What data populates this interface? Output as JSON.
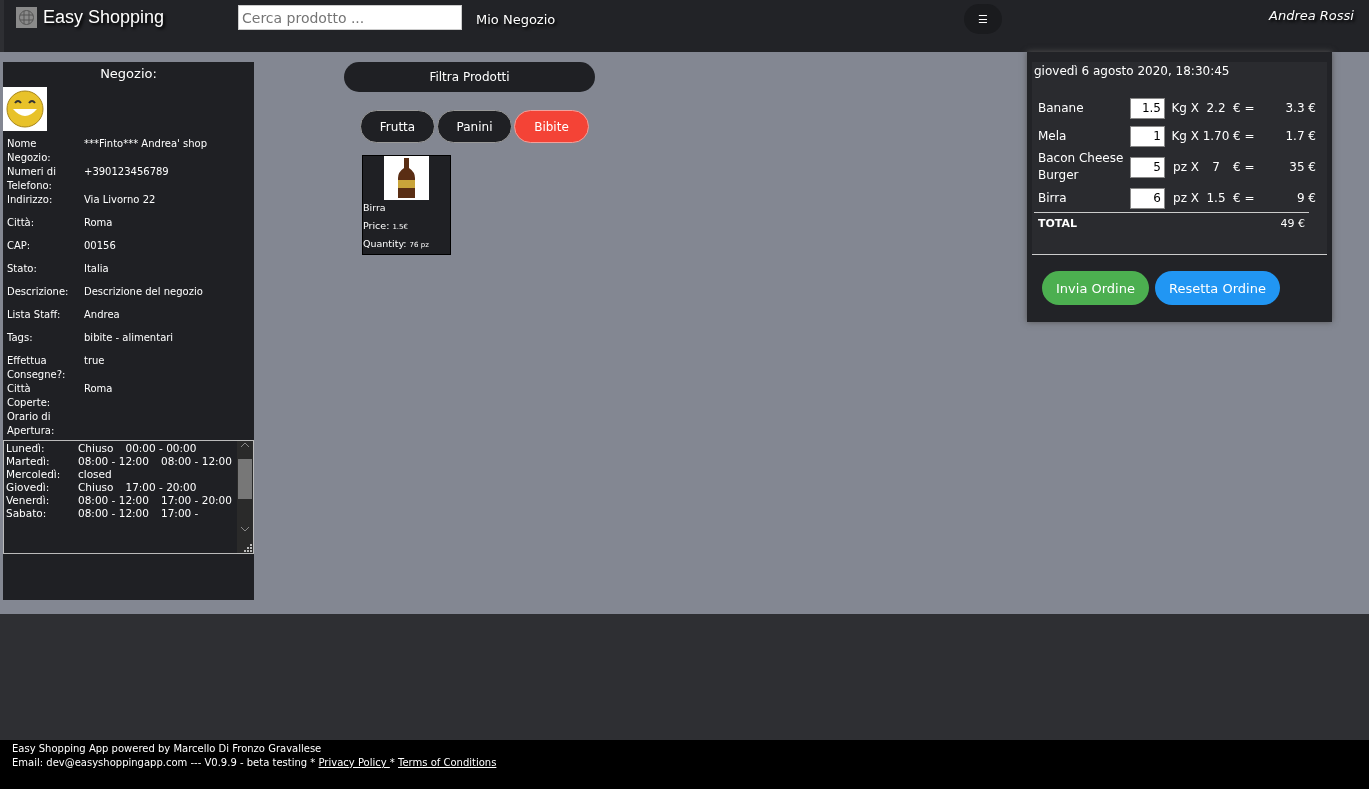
{
  "header": {
    "brand": "Easy Shopping",
    "search": {
      "placeholder": "Cerca prodotto ..."
    },
    "nav_link": "Mio Negozio",
    "menu_button": "☰",
    "user": "Andrea Rossi"
  },
  "shop": {
    "title": "Negozio:",
    "fields": [
      {
        "label": "Nome Negozio:",
        "value": "***Finto*** Andrea' shop"
      },
      {
        "label": "Numeri di Telefono:",
        "value": "+390123456789"
      },
      {
        "label": "Indirizzo:",
        "value": "Via Livorno 22"
      },
      {
        "label": "Città:",
        "value": "Roma"
      },
      {
        "label": "CAP:",
        "value": "00156"
      },
      {
        "label": "Stato:",
        "value": "Italia"
      },
      {
        "label": "Descrizione:",
        "value": "Descrizione del negozio"
      },
      {
        "label": "Lista Staff:",
        "value": "Andrea"
      },
      {
        "label": "Tags:",
        "value": "bibite - alimentari"
      },
      {
        "label": "Effettua Consegne?:",
        "value": "true"
      },
      {
        "label": "Città Coperte:",
        "value": "Roma"
      },
      {
        "label": "Orario di Apertura:"
      }
    ],
    "hours": [
      {
        "day": "Lunedì:",
        "slots": [
          "Chiuso",
          "00:00 - 00:00"
        ]
      },
      {
        "day": "Martedì:",
        "slots": [
          "08:00 - 12:00",
          "08:00 - 12:00"
        ]
      },
      {
        "day": "Mercoledì:",
        "slots": [
          "closed"
        ]
      },
      {
        "day": "Giovedì:",
        "slots": [
          "Chiuso",
          "17:00 - 20:00"
        ]
      },
      {
        "day": "Venerdì:",
        "slots": [
          "08:00 - 12:00",
          "17:00 - 20:00"
        ]
      },
      {
        "day": "Sabato:",
        "slots": [
          "08:00 - 12:00",
          "17:00 -"
        ]
      }
    ]
  },
  "filter": {
    "title": "Filtra Prodotti",
    "categories": [
      {
        "label": "Frutta",
        "selected": false
      },
      {
        "label": "Panini",
        "selected": false
      },
      {
        "label": "Bibite",
        "selected": true
      }
    ]
  },
  "products": [
    {
      "name": "Birra",
      "price_label": "Price:",
      "price": "1.5€",
      "quantity_label": "Quantity:",
      "quantity": "76 pz"
    }
  ],
  "cart": {
    "date": "giovedì 6 agosto 2020, 18:30:45",
    "items": [
      {
        "name": "Banane",
        "qty": "1.5",
        "unit": "Kg X",
        "price": "2.2",
        "eq": "€ =",
        "total": "3.3 €"
      },
      {
        "name": "Mela",
        "qty": "1",
        "unit": "Kg X",
        "price": "1.70",
        "eq": "€ =",
        "total": "1.7 €"
      },
      {
        "name": "Bacon Cheese Burger",
        "qty": "5",
        "unit": "pz X",
        "price": "7",
        "eq": "€ =",
        "total": "35 €"
      },
      {
        "name": "Birra",
        "qty": "6",
        "unit": "pz X",
        "price": "1.5",
        "eq": "€ =",
        "total": "9 €"
      }
    ],
    "total_label": "TOTAL",
    "total": "49 €",
    "buttons": [
      {
        "label": "Invia Ordine",
        "kind": "send"
      },
      {
        "label": "Resetta Ordine",
        "kind": "reset"
      }
    ]
  },
  "footer": {
    "credit": "Easy Shopping App powered by Marcello Di Fronzo Gravallese",
    "info": "Email: dev@easyshoppingapp.com --- V0.9.9 - beta testing *",
    "privacy": "Privacy Policy ",
    "sep": "*",
    "terms": "Terms of Conditions"
  }
}
